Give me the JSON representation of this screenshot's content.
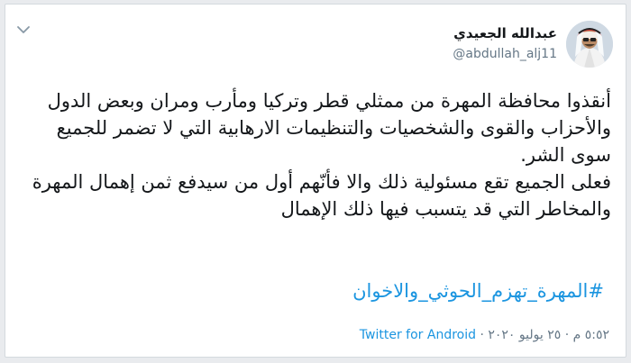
{
  "tweet": {
    "author_name": "عبدالله الجعيدي",
    "handle": "@abdullah_alj11",
    "paragraph_1": "أنقذوا محافظة المهرة من ممثلي قطر وتركيا ومأرب ومران وبعض الدول والأحزاب والقوى والشخصيات والتنظيمات الارهابية التي لا تضمر للجميع سوى الشر.",
    "paragraph_2": "فعلى الجميع تقع مسئولية ذلك والا فأنّهم أول من سيدفع ثمن إهمال المهرة والمخاطر التي قد يتسبب فيها ذلك الإهمال",
    "hashtag": "#المهرة_تهزم_الحوثي_والاخوان",
    "timestamp": "٥:٥٢ م · ٢٥ يوليو ٢٠٢٠ ·",
    "source": "Twitter for Android"
  },
  "icons": {
    "menu": "chevron-down-icon",
    "avatar": "profile-photo"
  },
  "colors": {
    "link": "#1b95e0",
    "text": "#14171a",
    "secondary": "#657786"
  }
}
